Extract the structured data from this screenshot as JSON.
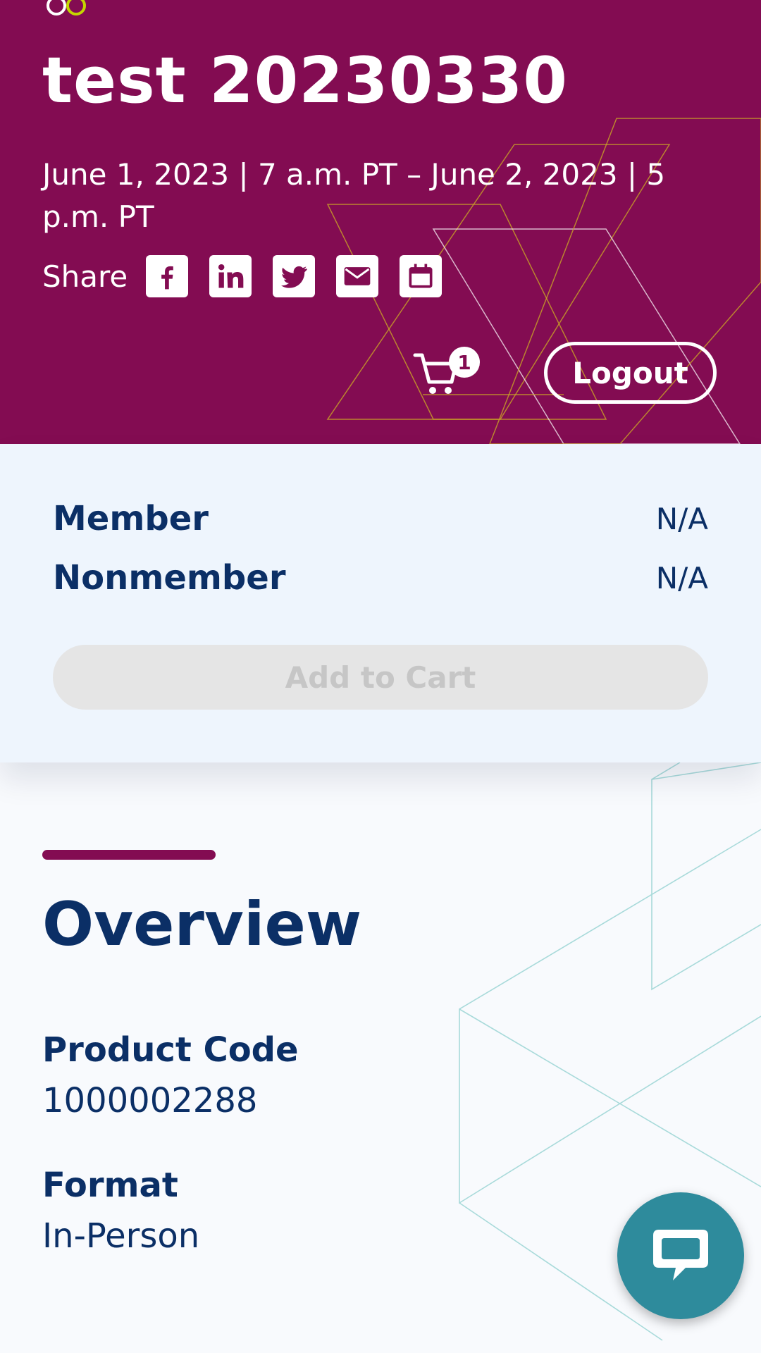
{
  "header": {
    "title": "test 20230330",
    "dates": "June 1, 2023 | 7 a.m. PT – June 2, 2023 | 5 p.m. PT",
    "share_label": "Share",
    "share_icons": [
      "facebook-icon",
      "linkedin-icon",
      "twitter-icon",
      "email-icon",
      "calendar-icon"
    ],
    "cart_count": "1",
    "logout_label": "Logout"
  },
  "pricing": {
    "rows": [
      {
        "label": "Member",
        "value": "N/A"
      },
      {
        "label": "Nonmember",
        "value": "N/A"
      }
    ],
    "add_to_cart_label": "Add to Cart"
  },
  "overview": {
    "heading": "Overview",
    "fields": [
      {
        "label": "Product Code",
        "value": "1000002288"
      },
      {
        "label": "Format",
        "value": "In-Person"
      }
    ]
  },
  "colors": {
    "brand": "#830c52",
    "navy": "#0b2f66",
    "chat": "#2e8b9c"
  },
  "chat": {
    "icon": "chat-bubble-icon"
  }
}
